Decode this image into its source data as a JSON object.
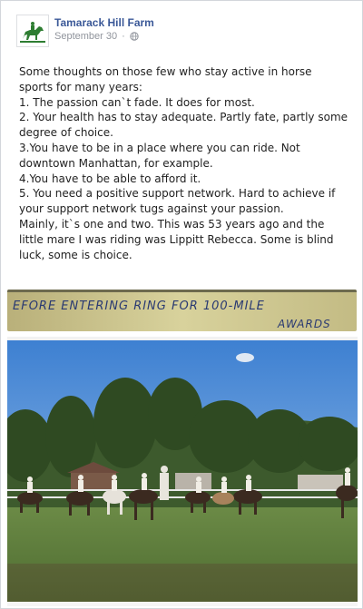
{
  "post": {
    "page_name": "Tamarack Hill Farm",
    "date": "September 30",
    "privacy_icon": "globe-icon",
    "lines": [
      "Some thoughts on those few who stay active in horse sports for many years:",
      "1. The passion can`t fade. It does for most.",
      "2. Your health has to stay adequate. Partly fate, partly some degree of choice.",
      "3.You have to be in a place where you can ride. Not downtown Manhattan, for example.",
      "4.You have to be able to afford it.",
      "5. You need a positive support network. Hard to achieve if your support network tugs against your passion.",
      "Mainly, it`s one and two. This was 53 years ago and the little mare I was riding was Lippitt Rebecca. Some is blind luck, some is choice."
    ]
  },
  "photo_caption": {
    "line1": "EFORE ENTERING RING   FOR 100-MILE",
    "line2": "AWARDS"
  },
  "colors": {
    "link": "#3b5998",
    "meta": "#90949c",
    "avatar_green": "#2e7d32"
  }
}
